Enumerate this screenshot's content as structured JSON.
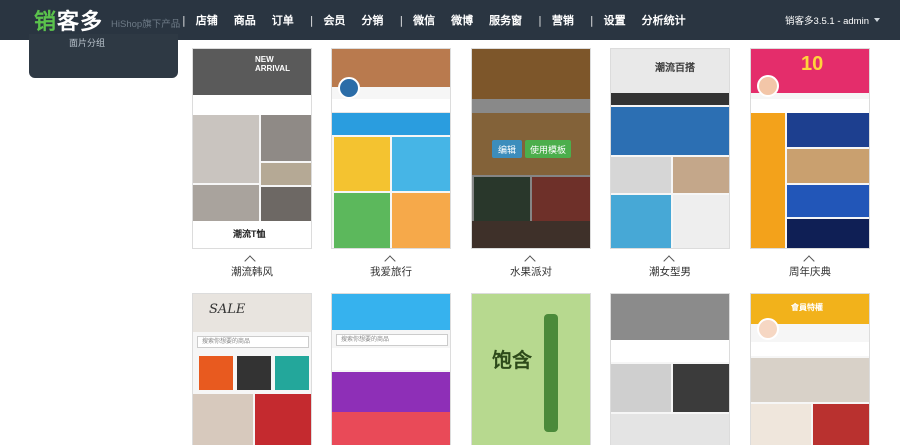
{
  "brand": {
    "name_part1": "销",
    "name_part2": "客多",
    "tagline": "HiShop旗下产品"
  },
  "nav": {
    "items": [
      {
        "label": "店铺",
        "active": true
      },
      {
        "label": "商品"
      },
      {
        "label": "订单"
      },
      {
        "label": "会员"
      },
      {
        "label": "分销"
      },
      {
        "label": "微信"
      },
      {
        "label": "微博"
      },
      {
        "label": "服务窗"
      },
      {
        "label": "营销"
      },
      {
        "label": "设置"
      },
      {
        "label": "分析统计"
      }
    ],
    "separator": "|"
  },
  "account": {
    "label": "销客多3.5.1 - admin"
  },
  "sidebar": {
    "partial_label": "面片分组"
  },
  "templates": {
    "row1": [
      {
        "name": "潮流韩风",
        "banner": "NEW ARRIVAL",
        "headline": "潮流T恤",
        "theme": "#2b2b2b"
      },
      {
        "name": "我爱旅行",
        "theme": "#2a9ddf"
      },
      {
        "name": "水果派对",
        "hovered": true,
        "theme": "#e0882c"
      },
      {
        "name": "潮女型男",
        "banner": "潮流百搭",
        "theme": "#1d5fa8"
      },
      {
        "name": "周年庆典",
        "banner": "10",
        "theme": "#e42d6b"
      }
    ],
    "row2": [
      {
        "name": "",
        "banner": "SALE",
        "search": "搜索你想要的商品",
        "theme": "#444"
      },
      {
        "name": "",
        "search": "搜索你想要的商品",
        "theme": "#1aa0e5"
      },
      {
        "name": "",
        "banner": "饱含",
        "theme": "#6ab04c"
      },
      {
        "name": "",
        "theme": "#555"
      },
      {
        "name": "",
        "banner": "會員特權",
        "theme": "#f2b21b"
      }
    ]
  },
  "hover_buttons": {
    "edit": "编辑",
    "use": "使用模板"
  },
  "colors": {
    "topbar": "#2a3541",
    "accent_green": "#4cae4c",
    "accent_blue": "#3c8dbc"
  }
}
